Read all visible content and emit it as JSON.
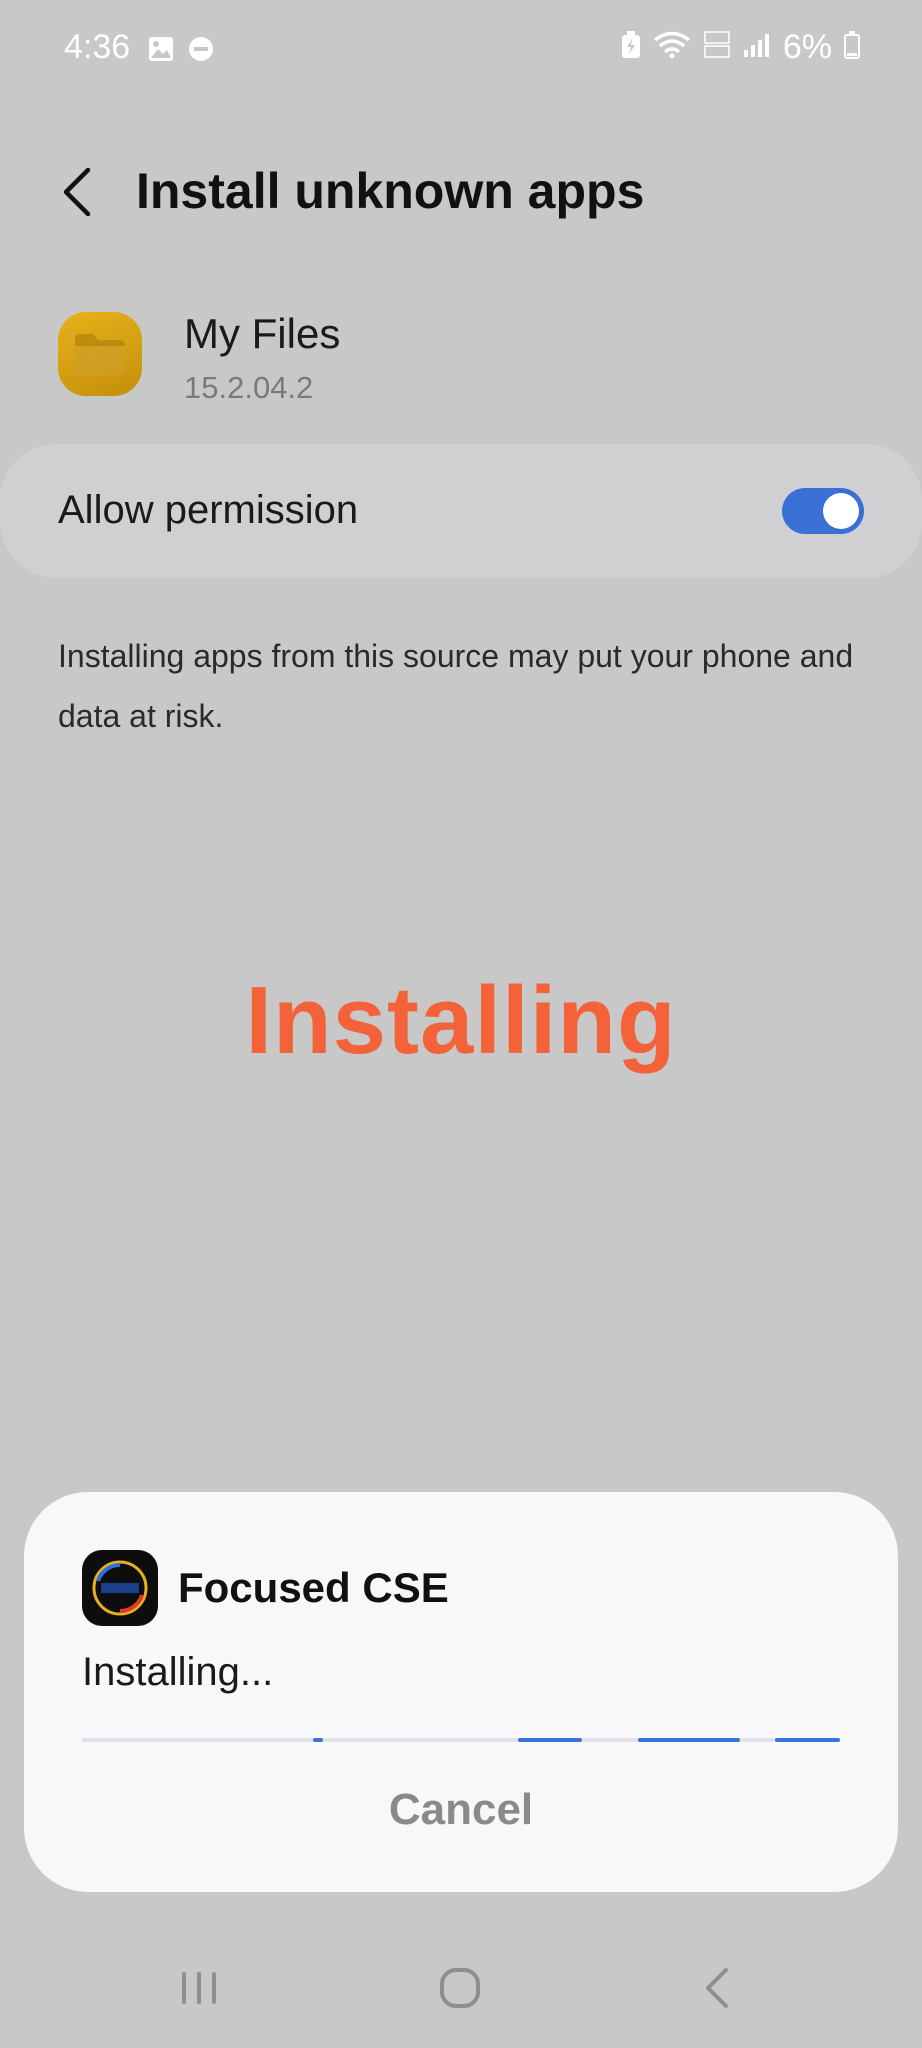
{
  "status_bar": {
    "time": "4:36",
    "battery_text": "6%"
  },
  "header": {
    "title": "Install unknown apps"
  },
  "app": {
    "name": "My Files",
    "version": "15.2.04.2"
  },
  "permission": {
    "label": "Allow permission",
    "enabled": true
  },
  "warning": {
    "text": "Installing apps from this source may put your phone and data at risk."
  },
  "overlay": {
    "text": "Installing"
  },
  "dialog": {
    "app_name": "Focused CSE",
    "status": "Installing...",
    "cancel_label": "Cancel"
  },
  "colors": {
    "accent": "#3a6fd6",
    "overlay_text": "#f4623a",
    "background": "#c8c8c8"
  }
}
